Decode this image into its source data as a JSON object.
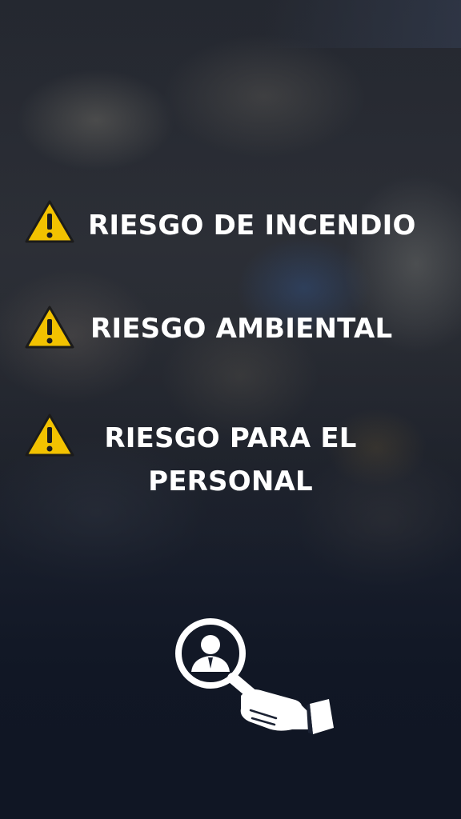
{
  "risks": [
    {
      "icon": "warning-icon",
      "label": "RIESGO DE INCENDIO"
    },
    {
      "icon": "warning-icon",
      "label": "RIESGO AMBIENTAL"
    },
    {
      "icon": "warning-icon",
      "label": "RIESGO PARA EL PERSONAL"
    }
  ],
  "emblem": {
    "icon": "magnifier-person-search-icon"
  },
  "colors": {
    "warning_fill": "#f2c200",
    "warning_stroke": "#1b1b1b",
    "text": "#ffffff",
    "background_bottom": "#131a2a"
  }
}
